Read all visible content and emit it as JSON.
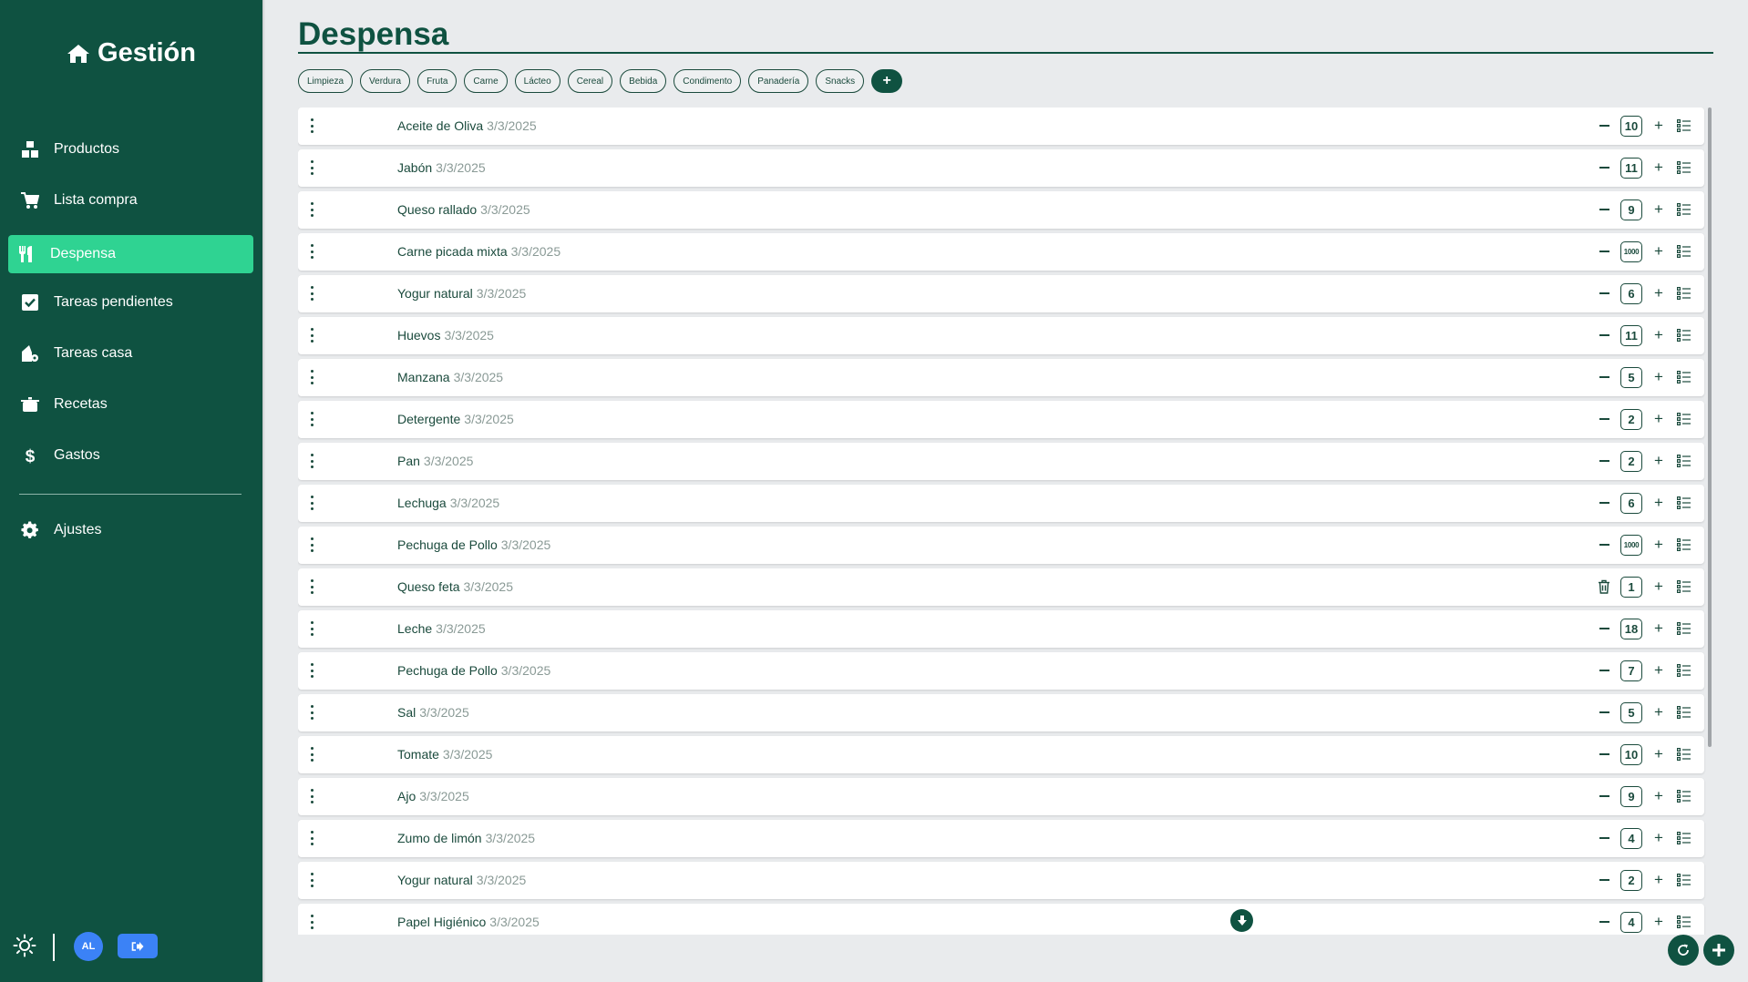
{
  "brand": {
    "title": "Gestión"
  },
  "nav": {
    "items": [
      {
        "label": "Productos",
        "icon": "boxes-icon"
      },
      {
        "label": "Lista compra",
        "icon": "cart-icon"
      },
      {
        "label": "Despensa",
        "icon": "utensils-icon",
        "active": true
      },
      {
        "label": "Tareas pendientes",
        "icon": "checkbox-icon"
      },
      {
        "label": "Tareas casa",
        "icon": "house-gear-icon"
      },
      {
        "label": "Recetas",
        "icon": "pot-icon"
      },
      {
        "label": "Gastos",
        "icon": "dollar-icon"
      }
    ],
    "settings": {
      "label": "Ajustes",
      "icon": "gear-icon"
    }
  },
  "footer": {
    "avatar_initials": "AL"
  },
  "page": {
    "title": "Despensa"
  },
  "categories": [
    "Limpieza",
    "Verdura",
    "Fruta",
    "Carne",
    "Lácteo",
    "Cereal",
    "Bebida",
    "Condimento",
    "Panadería",
    "Snacks"
  ],
  "add_category_label": "+",
  "items": [
    {
      "name": "Aceite de Oliva",
      "date": "3/3/2025",
      "qty": "10"
    },
    {
      "name": "Jabón",
      "date": "3/3/2025",
      "qty": "11"
    },
    {
      "name": "Queso rallado",
      "date": "3/3/2025",
      "qty": "9"
    },
    {
      "name": "Carne picada mixta",
      "date": "3/3/2025",
      "qty": "1000"
    },
    {
      "name": "Yogur natural",
      "date": "3/3/2025",
      "qty": "6"
    },
    {
      "name": "Huevos",
      "date": "3/3/2025",
      "qty": "11"
    },
    {
      "name": "Manzana",
      "date": "3/3/2025",
      "qty": "5"
    },
    {
      "name": "Detergente",
      "date": "3/3/2025",
      "qty": "2"
    },
    {
      "name": "Pan",
      "date": "3/3/2025",
      "qty": "2"
    },
    {
      "name": "Lechuga",
      "date": "3/3/2025",
      "qty": "6"
    },
    {
      "name": "Pechuga de Pollo",
      "date": "3/3/2025",
      "qty": "1000"
    },
    {
      "name": "Queso feta",
      "date": "3/3/2025",
      "qty": "1",
      "trash": true
    },
    {
      "name": "Leche",
      "date": "3/3/2025",
      "qty": "18"
    },
    {
      "name": "Pechuga de Pollo",
      "date": "3/3/2025",
      "qty": "7"
    },
    {
      "name": "Sal",
      "date": "3/3/2025",
      "qty": "5"
    },
    {
      "name": "Tomate",
      "date": "3/3/2025",
      "qty": "10"
    },
    {
      "name": "Ajo",
      "date": "3/3/2025",
      "qty": "9"
    },
    {
      "name": "Zumo de limón",
      "date": "3/3/2025",
      "qty": "4"
    },
    {
      "name": "Yogur natural",
      "date": "3/3/2025",
      "qty": "2"
    },
    {
      "name": "Papel Higiénico",
      "date": "3/3/2025",
      "qty": "4"
    }
  ],
  "colors": {
    "sidebar": "#0f5241",
    "active": "#2fd392",
    "accent_blue": "#3b82f6"
  }
}
